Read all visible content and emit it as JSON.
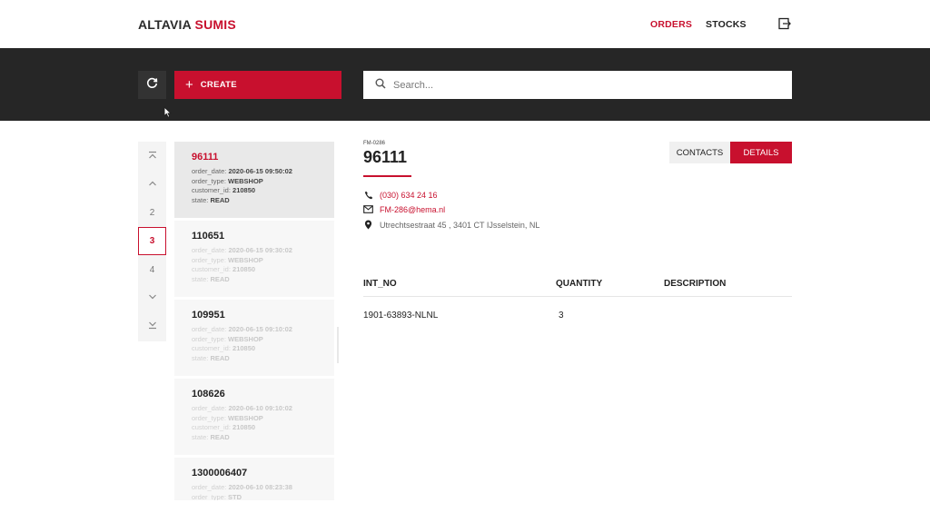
{
  "brand": {
    "part1": "ALTAVIA",
    "part2": "SUMIS"
  },
  "nav": {
    "orders": "ORDERS",
    "stocks": "STOCKS"
  },
  "toolbar": {
    "create_label": "CREATE",
    "search_placeholder": "Search..."
  },
  "pager": {
    "pages": [
      "2",
      "3",
      "4"
    ],
    "current": "3"
  },
  "orders": [
    {
      "id": "96111",
      "order_date": "2020-06-15 09:50:02",
      "order_type": "WEBSHOP",
      "customer_id": "210850",
      "state": "READ",
      "selected": true
    },
    {
      "id": "110651",
      "order_date": "2020-06-15 09:30:02",
      "order_type": "WEBSHOP",
      "customer_id": "210850",
      "state": "READ"
    },
    {
      "id": "109951",
      "order_date": "2020-06-15 09:10:02",
      "order_type": "WEBSHOP",
      "customer_id": "210850",
      "state": "READ"
    },
    {
      "id": "108626",
      "order_date": "2020-06-10 09:10:02",
      "order_type": "WEBSHOP",
      "customer_id": "210850",
      "state": "READ"
    },
    {
      "id": "1300006407",
      "order_date": "2020-06-10 08:23:38",
      "order_type": "STD"
    }
  ],
  "labels": {
    "order_date": "order_date:",
    "order_type": "order_type:",
    "customer_id": "customer_id:",
    "state": "state:"
  },
  "detail": {
    "code": "FM-0286",
    "title": "96111",
    "tabs": {
      "contacts": "CONTACTS",
      "details": "DETAILS"
    },
    "phone": "(030) 634 24 16",
    "email": "FM-286@hema.nl",
    "address": "Utrechtsestraat 45 , 3401 CT IJsselstein, NL",
    "table": {
      "headers": [
        "INT_NO",
        "QUANTITY",
        "DESCRIPTION"
      ],
      "rows": [
        [
          "1901-63893-NLNL",
          "3",
          ""
        ]
      ]
    }
  },
  "colors": {
    "accent": "#c8102e",
    "toolbar_bg": "#262626"
  }
}
